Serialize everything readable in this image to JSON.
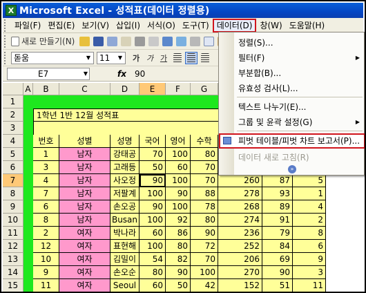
{
  "window": {
    "title": "Microsoft Excel - 성적표(데이터 정렬용)"
  },
  "menubar": {
    "items": [
      "파일(F)",
      "편집(E)",
      "보기(V)",
      "삽입(I)",
      "서식(O)",
      "도구(T)",
      "데이터(D)",
      "창(W)",
      "도움말(H)"
    ],
    "active": "데이터(D)"
  },
  "toolbar": {
    "new_label": "새로 만들기(N)",
    "font_name": "돋움",
    "font_size": "11",
    "bold": "가",
    "italic": "가",
    "underline": "가"
  },
  "formula_bar": {
    "name_box": "E7",
    "fx": "fx",
    "value": "90"
  },
  "columns": [
    "A",
    "B",
    "C",
    "D",
    "E",
    "F",
    "G"
  ],
  "rows": [
    "1",
    "2",
    "3",
    "4",
    "5",
    "6",
    "7",
    "8",
    "9",
    "10",
    "11",
    "12",
    "13",
    "14",
    "15"
  ],
  "sheet": {
    "title": "1학년 1반 12월 성적표",
    "headers": [
      "번호",
      "성별",
      "성명",
      "국어",
      "영어",
      "수학"
    ],
    "data": [
      [
        "1",
        "남자",
        "강태공",
        "70",
        "100",
        "80"
      ],
      [
        "3",
        "남자",
        "고래등",
        "50",
        "60",
        "70"
      ],
      [
        "4",
        "남자",
        "사오정",
        "90",
        "100",
        "70"
      ],
      [
        "7",
        "남자",
        "저팔계",
        "100",
        "90",
        "88"
      ],
      [
        "6",
        "남자",
        "손오공",
        "90",
        "100",
        "78"
      ],
      [
        "8",
        "남자",
        "Busan",
        "100",
        "92",
        "80"
      ],
      [
        "2",
        "여자",
        "박나라",
        "60",
        "86",
        "90"
      ],
      [
        "12",
        "여자",
        "표현해",
        "100",
        "80",
        "72"
      ],
      [
        "10",
        "여자",
        "김밀이",
        "54",
        "82",
        "70"
      ],
      [
        "9",
        "여자",
        "손오순",
        "80",
        "90",
        "100"
      ],
      [
        "11",
        "여자",
        "Seoul",
        "60",
        "50",
        "42"
      ]
    ],
    "extra_columns": [
      [
        "278",
        "93",
        "1"
      ],
      [
        "268",
        "89",
        "4"
      ],
      [
        "274",
        "91",
        "2"
      ],
      [
        "236",
        "79",
        "8"
      ],
      [
        "252",
        "84",
        "6"
      ],
      [
        "206",
        "69",
        "9"
      ],
      [
        "270",
        "90",
        "3"
      ],
      [
        "152",
        "51",
        "11"
      ]
    ],
    "row7_partial": [
      "260",
      "87",
      "5"
    ]
  },
  "data_menu": {
    "items": [
      {
        "label": "정렬(S)...",
        "submenu": false,
        "disabled": false
      },
      {
        "label": "필터(F)",
        "submenu": true,
        "disabled": false
      },
      {
        "label": "부분합(B)...",
        "submenu": false,
        "disabled": false
      },
      {
        "label": "유효성 검사(L)...",
        "submenu": false,
        "disabled": false
      },
      {
        "label": "텍스트 나누기(E)...",
        "submenu": false,
        "disabled": false
      },
      {
        "label": "그룹 및 윤곽 설정(G)",
        "submenu": true,
        "disabled": false
      },
      {
        "label": "피벗 테이블/피벗 차트 보고서(P)...",
        "submenu": false,
        "disabled": false
      },
      {
        "label": "데이터 새로 고침(R)",
        "submenu": false,
        "disabled": true
      }
    ],
    "highlighted": "피벗 테이블/피벗 차트 보고서(P)..."
  },
  "colors": {
    "accent_red": "#d0141c",
    "green": "#1ee81e",
    "pink": "#ff99cc",
    "yellow": "#ffff99",
    "title_blue": "#0446c4"
  }
}
